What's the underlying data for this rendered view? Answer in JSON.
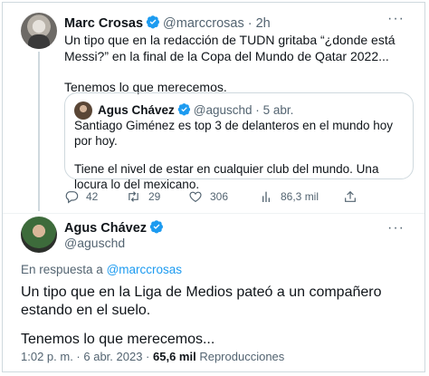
{
  "tweet1": {
    "name": "Marc Crosas",
    "handle": "@marccrosas",
    "separator": "·",
    "time": "2h",
    "more": "···",
    "line1": "Un tipo que en la redacción de TUDN gritaba “¿donde está Messi?” en la final de la Copa del Mundo de Qatar 2022...",
    "line2": "Tenemos lo que merecemos.",
    "quote": {
      "name": "Agus Chávez",
      "handle": "@aguschd",
      "separator": "·",
      "date": "5 abr.",
      "line1": "Santiago Giménez es top 3 de delanteros en el mundo hoy por hoy.",
      "line2": "Tiene el nivel de estar en cualquier club del mundo. Una locura lo del mexicano."
    },
    "actions": {
      "replies": "42",
      "retweets": "29",
      "likes": "306",
      "views": "86,3 mil"
    }
  },
  "tweet2": {
    "name": "Agus Chávez",
    "handle": "@aguschd",
    "more": "···",
    "reply_prefix": "En respuesta a ",
    "reply_handle": "@marccrosas",
    "line1": "Un tipo que en la Liga de Medios pateó a un compañero estando en el suelo.",
    "line2": "Tenemos lo que merecemos...",
    "time": "1:02 p. m.",
    "date": "6 abr. 2023",
    "views_count": "65,6 mil",
    "views_label": "Reproducciones"
  },
  "colors": {
    "verified": "#1d9bf0",
    "text": "#0f1419",
    "muted": "#536471",
    "link": "#1d9bf0",
    "border": "#cfd9de"
  }
}
